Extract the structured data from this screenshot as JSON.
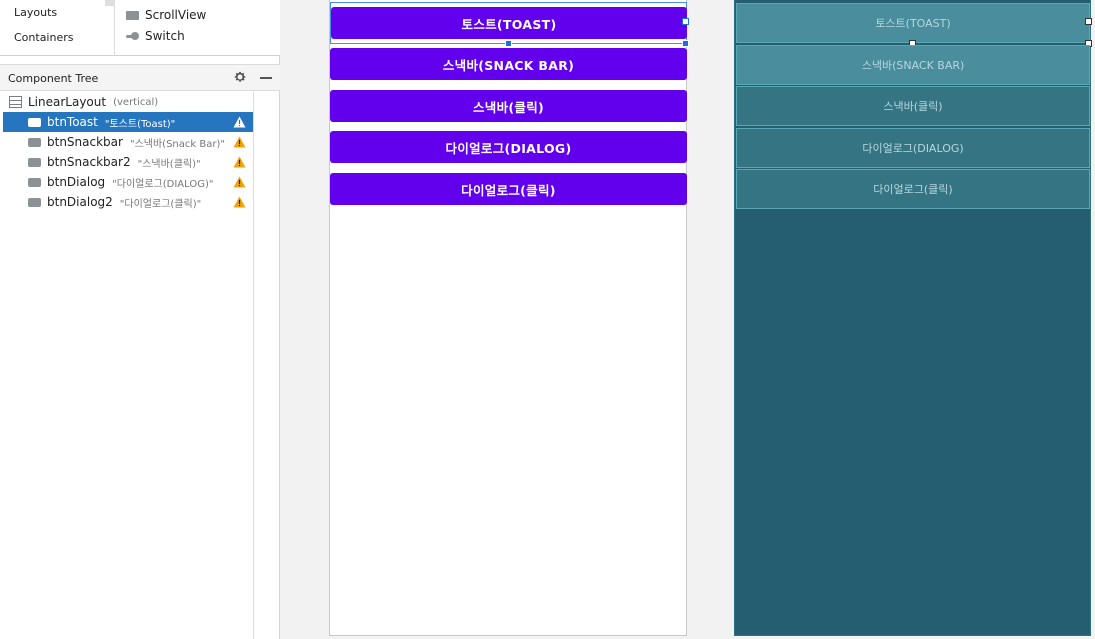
{
  "palette": {
    "categories": [
      "Layouts",
      "Containers"
    ],
    "items": [
      {
        "label": "ScrollView",
        "icon": "scrollview-icon"
      },
      {
        "label": "Switch",
        "icon": "switch-icon"
      }
    ]
  },
  "component_tree": {
    "title": "Component Tree",
    "root": {
      "id": "LinearLayout",
      "hint": "(vertical)"
    },
    "children": [
      {
        "id": "btnToast",
        "text": "\"토스트(Toast)\"",
        "selected": true
      },
      {
        "id": "btnSnackbar",
        "text": "\"스낵바(Snack Bar)\"",
        "selected": false
      },
      {
        "id": "btnSnackbar2",
        "text": "\"스낵바(클릭)\"",
        "selected": false
      },
      {
        "id": "btnDialog",
        "text": "\"다이얼로그(DIALOG)\"",
        "selected": false
      },
      {
        "id": "btnDialog2",
        "text": "\"다이얼로그(클릭)\"",
        "selected": false
      }
    ]
  },
  "design": {
    "buttons": [
      "토스트(TOAST)",
      "스낵바(SNACK BAR)",
      "스낵바(클릭)",
      "다이얼로그(DIALOG)",
      "다이얼로그(클릭)"
    ]
  },
  "blueprint": {
    "buttons": [
      "토스트(TOAST)",
      "스낵바(SNACK BAR)",
      "스낵바(클릭)",
      "다이얼로그(DIALOG)",
      "다이얼로그(클릭)"
    ]
  },
  "colors": {
    "accent": "#6200ee",
    "selection": "#2675bf",
    "blueprint_bg": "#255e70",
    "warning": "#f0a30a"
  }
}
